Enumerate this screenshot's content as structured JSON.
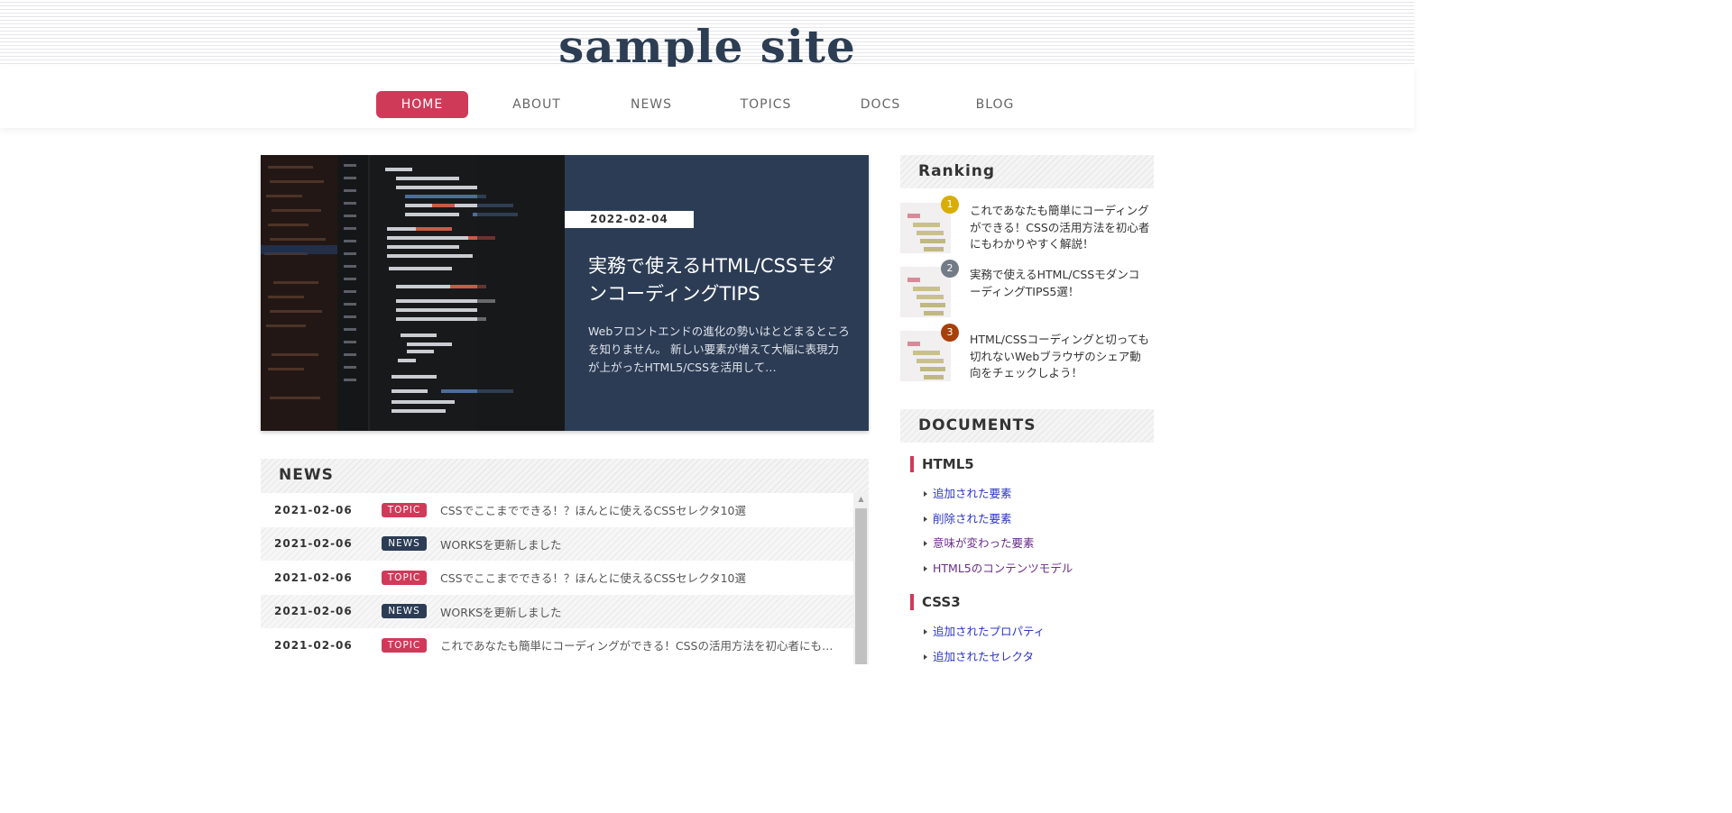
{
  "site": {
    "logo": "sample site"
  },
  "nav": [
    {
      "label": "HOME",
      "active": true
    },
    {
      "label": "ABOUT"
    },
    {
      "label": "NEWS"
    },
    {
      "label": "TOPICS"
    },
    {
      "label": "DOCS"
    },
    {
      "label": "BLOG"
    }
  ],
  "hero": {
    "date": "2022-02-04",
    "title": "実務で使えるHTML/CSSモダンコーディングTIPS",
    "text": "Webフロントエンドの進化の勢いはとどまるところを知りません。 新しい要素が増えて大幅に表現力が上がったHTML5/CSSを活用して…"
  },
  "news": {
    "heading": "NEWS",
    "rows": [
      {
        "date": "2021-02-06",
        "tag": "TOPIC",
        "title": "CSSでここまでできる！？ほんとに使えるCSSセレクタ10選"
      },
      {
        "date": "2021-02-06",
        "tag": "NEWS",
        "title": "WORKSを更新しました"
      },
      {
        "date": "2021-02-06",
        "tag": "TOPIC",
        "title": "CSSでここまでできる！？ほんとに使えるCSSセレクタ10選"
      },
      {
        "date": "2021-02-06",
        "tag": "NEWS",
        "title": "WORKSを更新しました"
      },
      {
        "date": "2021-02-06",
        "tag": "TOPIC",
        "title": "これであなたも簡単にコーディングができる！CSSの活用方法を初心者にもわかりやすく解説！"
      }
    ]
  },
  "ranking": {
    "heading": "Ranking",
    "items": [
      {
        "rank": "1",
        "color": "#d8ad07",
        "title": "これであなたも簡単にコーディングができる！CSSの活用方法を初心者にもわかりやすく解説！"
      },
      {
        "rank": "2",
        "color": "#727b86",
        "title": "実務で使えるHTML/CSSモダンコーディングTIPS5選！"
      },
      {
        "rank": "3",
        "color": "#a6400b",
        "title": "HTML/CSSコーディングと切っても切れないWebブラウザのシェア動向をチェックしよう！"
      }
    ]
  },
  "documents": {
    "heading": "DOCUMENTS",
    "html5": {
      "title": "HTML5",
      "links": [
        "追加された要素",
        "削除された要素",
        "意味が変わった要素",
        "HTML5のコンテンツモデル"
      ]
    },
    "css3": {
      "title": "CSS3",
      "links": [
        "追加されたプロパティ",
        "追加されたセレクタ"
      ]
    }
  }
}
